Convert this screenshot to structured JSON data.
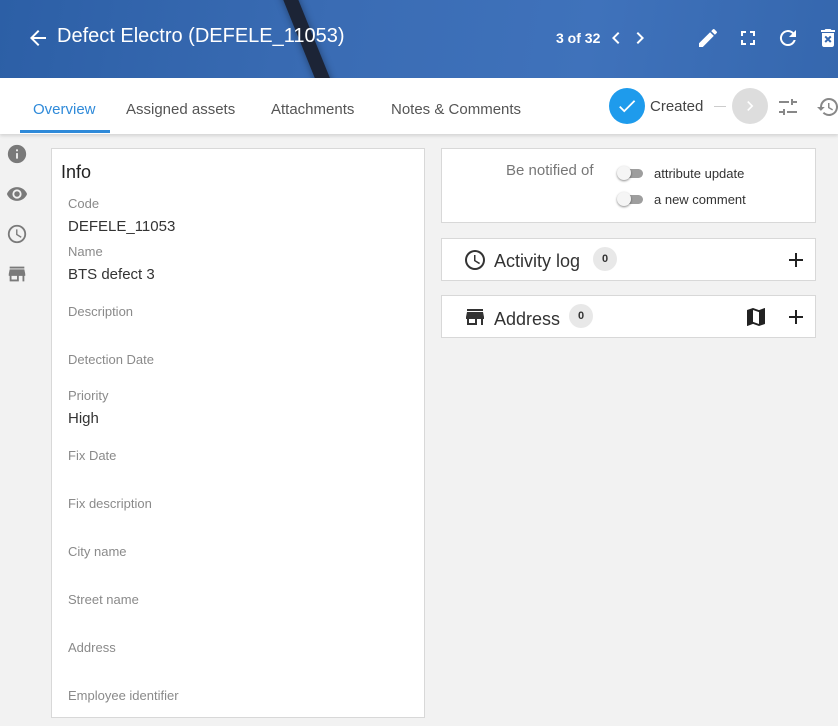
{
  "header": {
    "title": "Defect Electro (DEFELE_11053)",
    "pager": "3 of 32"
  },
  "tabs": [
    {
      "label": "Overview",
      "active": true
    },
    {
      "label": "Assigned assets"
    },
    {
      "label": "Attachments"
    },
    {
      "label": "Notes & Comments"
    }
  ],
  "status": {
    "current": "Created"
  },
  "info": {
    "title": "Info",
    "fields": [
      {
        "label": "Code",
        "value": "DEFELE_11053"
      },
      {
        "label": "Name",
        "value": "BTS defect 3"
      },
      {
        "label": "Description",
        "value": ""
      },
      {
        "label": "Detection Date",
        "value": ""
      },
      {
        "label": "Priority",
        "value": "High"
      },
      {
        "label": "Fix Date",
        "value": ""
      },
      {
        "label": "Fix description",
        "value": ""
      },
      {
        "label": "City name",
        "value": ""
      },
      {
        "label": "Street name",
        "value": ""
      },
      {
        "label": "Address",
        "value": ""
      },
      {
        "label": "Employee identifier",
        "value": ""
      }
    ]
  },
  "notify": {
    "label": "Be notified of",
    "options": [
      {
        "label": "attribute update",
        "on": false
      },
      {
        "label": "a new comment",
        "on": false
      }
    ]
  },
  "activity_log": {
    "title": "Activity log",
    "count": "0"
  },
  "address": {
    "title": "Address",
    "count": "0"
  },
  "colors": {
    "accent": "#2f8ad9",
    "header": "#3a6cb4",
    "status": "#1e9bec"
  }
}
